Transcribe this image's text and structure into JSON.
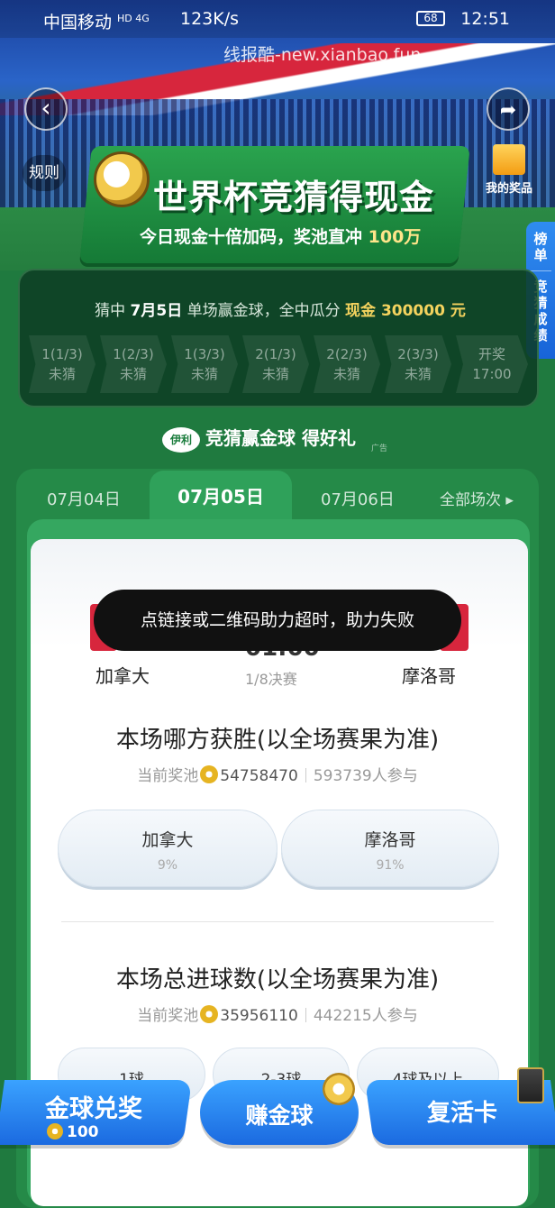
{
  "status_bar": {
    "carrier": "中国移动",
    "network": "HD 4G",
    "speed": "123K/s",
    "battery": "68",
    "time": "12:51"
  },
  "watermark": "线报酷-new.xianbao.fun",
  "header": {
    "back_icon": "back-arrow-icon",
    "share_icon": "share-arrow-icon",
    "rules_label": "规则",
    "my_prizes_label": "我的奖品"
  },
  "banner": {
    "title": "世界杯竞猜得现金",
    "subtitle_prefix": "今日现金十倍加码，奖池直冲",
    "subtitle_highlight": "100万"
  },
  "side_tabs": [
    "榜单",
    "竞猜成绩"
  ],
  "progress": {
    "text_prefix": "猜中",
    "date": "7月5日",
    "text_mid": "单场赢金球，全中瓜分",
    "prize": "现金 300000 元",
    "steps": [
      {
        "label": "1(1/3)",
        "status": "未猜"
      },
      {
        "label": "1(2/3)",
        "status": "未猜"
      },
      {
        "label": "1(3/3)",
        "status": "未猜"
      },
      {
        "label": "2(1/3)",
        "status": "未猜"
      },
      {
        "label": "2(2/3)",
        "status": "未猜"
      },
      {
        "label": "2(3/3)",
        "status": "未猜"
      },
      {
        "label": "开奖",
        "status": "17:00"
      }
    ]
  },
  "ad": {
    "logo_text": "伊利",
    "text": "竞猜赢金球 得好礼",
    "tag": "广告"
  },
  "date_tabs": {
    "prev": "07月04日",
    "active": "07月05日",
    "next": "07月06日",
    "all": "全部场次 ▸"
  },
  "match": {
    "team_a": "加拿大",
    "team_b": "摩洛哥",
    "time_partial": "01:00",
    "stage": "1/8决赛"
  },
  "toast": "点链接或二维码助力超时，助力失败",
  "question1": {
    "title": "本场哪方获胜(以全场赛果为准)",
    "pool_label": "当前奖池",
    "pool_amount": "54758470",
    "participants": "593739人参与",
    "options": [
      {
        "name": "加拿大",
        "pct": "9%"
      },
      {
        "name": "摩洛哥",
        "pct": "91%"
      }
    ]
  },
  "question2": {
    "title": "本场总进球数(以全场赛果为准)",
    "pool_label": "当前奖池",
    "pool_amount": "35956110",
    "participants": "442215人参与",
    "options": [
      "1球",
      "2-3球",
      "4球及以上"
    ]
  },
  "bottom": {
    "exchange_label": "金球兑奖",
    "exchange_count": "100",
    "earn_label": "赚金球",
    "revive_label": "复活卡"
  }
}
